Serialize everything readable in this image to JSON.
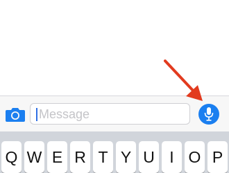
{
  "compose": {
    "placeholder": "Message"
  },
  "keyboard": {
    "row1": [
      "Q",
      "W",
      "E",
      "R",
      "T",
      "Y",
      "U",
      "I",
      "O",
      "P"
    ]
  },
  "colors": {
    "accent": "#1b7ff0",
    "annotation_arrow": "#e23b1f",
    "keyboard_bg": "#d1d5db",
    "compose_bar_bg": "#f7f7f7",
    "placeholder": "#c4c4c8"
  },
  "icons": {
    "camera": "camera-icon",
    "microphone": "microphone-icon",
    "annotation": "red-arrow-icon"
  }
}
